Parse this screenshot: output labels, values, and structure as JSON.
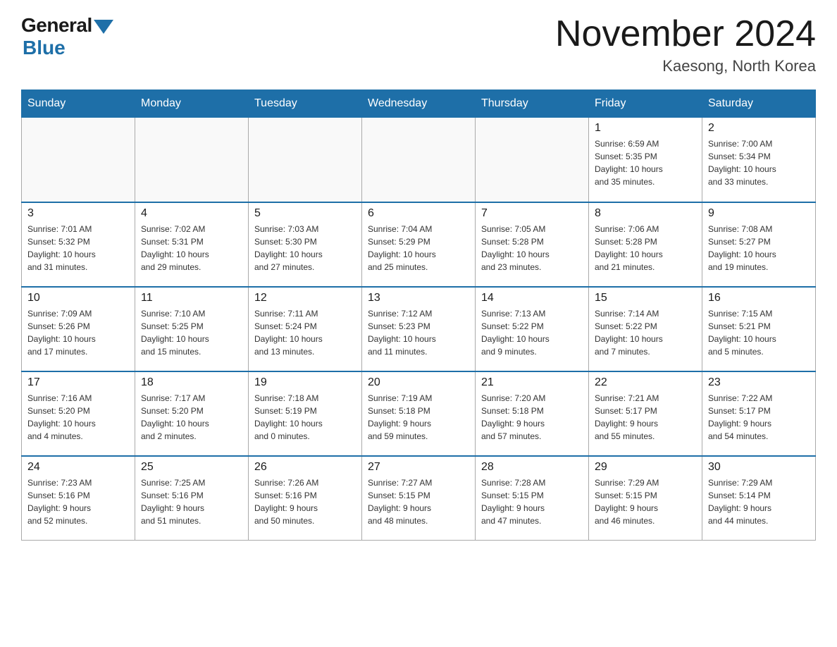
{
  "logo": {
    "general": "General",
    "blue": "Blue"
  },
  "title": "November 2024",
  "location": "Kaesong, North Korea",
  "days_of_week": [
    "Sunday",
    "Monday",
    "Tuesday",
    "Wednesday",
    "Thursday",
    "Friday",
    "Saturday"
  ],
  "weeks": [
    [
      {
        "day": "",
        "info": ""
      },
      {
        "day": "",
        "info": ""
      },
      {
        "day": "",
        "info": ""
      },
      {
        "day": "",
        "info": ""
      },
      {
        "day": "",
        "info": ""
      },
      {
        "day": "1",
        "info": "Sunrise: 6:59 AM\nSunset: 5:35 PM\nDaylight: 10 hours\nand 35 minutes."
      },
      {
        "day": "2",
        "info": "Sunrise: 7:00 AM\nSunset: 5:34 PM\nDaylight: 10 hours\nand 33 minutes."
      }
    ],
    [
      {
        "day": "3",
        "info": "Sunrise: 7:01 AM\nSunset: 5:32 PM\nDaylight: 10 hours\nand 31 minutes."
      },
      {
        "day": "4",
        "info": "Sunrise: 7:02 AM\nSunset: 5:31 PM\nDaylight: 10 hours\nand 29 minutes."
      },
      {
        "day": "5",
        "info": "Sunrise: 7:03 AM\nSunset: 5:30 PM\nDaylight: 10 hours\nand 27 minutes."
      },
      {
        "day": "6",
        "info": "Sunrise: 7:04 AM\nSunset: 5:29 PM\nDaylight: 10 hours\nand 25 minutes."
      },
      {
        "day": "7",
        "info": "Sunrise: 7:05 AM\nSunset: 5:28 PM\nDaylight: 10 hours\nand 23 minutes."
      },
      {
        "day": "8",
        "info": "Sunrise: 7:06 AM\nSunset: 5:28 PM\nDaylight: 10 hours\nand 21 minutes."
      },
      {
        "day": "9",
        "info": "Sunrise: 7:08 AM\nSunset: 5:27 PM\nDaylight: 10 hours\nand 19 minutes."
      }
    ],
    [
      {
        "day": "10",
        "info": "Sunrise: 7:09 AM\nSunset: 5:26 PM\nDaylight: 10 hours\nand 17 minutes."
      },
      {
        "day": "11",
        "info": "Sunrise: 7:10 AM\nSunset: 5:25 PM\nDaylight: 10 hours\nand 15 minutes."
      },
      {
        "day": "12",
        "info": "Sunrise: 7:11 AM\nSunset: 5:24 PM\nDaylight: 10 hours\nand 13 minutes."
      },
      {
        "day": "13",
        "info": "Sunrise: 7:12 AM\nSunset: 5:23 PM\nDaylight: 10 hours\nand 11 minutes."
      },
      {
        "day": "14",
        "info": "Sunrise: 7:13 AM\nSunset: 5:22 PM\nDaylight: 10 hours\nand 9 minutes."
      },
      {
        "day": "15",
        "info": "Sunrise: 7:14 AM\nSunset: 5:22 PM\nDaylight: 10 hours\nand 7 minutes."
      },
      {
        "day": "16",
        "info": "Sunrise: 7:15 AM\nSunset: 5:21 PM\nDaylight: 10 hours\nand 5 minutes."
      }
    ],
    [
      {
        "day": "17",
        "info": "Sunrise: 7:16 AM\nSunset: 5:20 PM\nDaylight: 10 hours\nand 4 minutes."
      },
      {
        "day": "18",
        "info": "Sunrise: 7:17 AM\nSunset: 5:20 PM\nDaylight: 10 hours\nand 2 minutes."
      },
      {
        "day": "19",
        "info": "Sunrise: 7:18 AM\nSunset: 5:19 PM\nDaylight: 10 hours\nand 0 minutes."
      },
      {
        "day": "20",
        "info": "Sunrise: 7:19 AM\nSunset: 5:18 PM\nDaylight: 9 hours\nand 59 minutes."
      },
      {
        "day": "21",
        "info": "Sunrise: 7:20 AM\nSunset: 5:18 PM\nDaylight: 9 hours\nand 57 minutes."
      },
      {
        "day": "22",
        "info": "Sunrise: 7:21 AM\nSunset: 5:17 PM\nDaylight: 9 hours\nand 55 minutes."
      },
      {
        "day": "23",
        "info": "Sunrise: 7:22 AM\nSunset: 5:17 PM\nDaylight: 9 hours\nand 54 minutes."
      }
    ],
    [
      {
        "day": "24",
        "info": "Sunrise: 7:23 AM\nSunset: 5:16 PM\nDaylight: 9 hours\nand 52 minutes."
      },
      {
        "day": "25",
        "info": "Sunrise: 7:25 AM\nSunset: 5:16 PM\nDaylight: 9 hours\nand 51 minutes."
      },
      {
        "day": "26",
        "info": "Sunrise: 7:26 AM\nSunset: 5:16 PM\nDaylight: 9 hours\nand 50 minutes."
      },
      {
        "day": "27",
        "info": "Sunrise: 7:27 AM\nSunset: 5:15 PM\nDaylight: 9 hours\nand 48 minutes."
      },
      {
        "day": "28",
        "info": "Sunrise: 7:28 AM\nSunset: 5:15 PM\nDaylight: 9 hours\nand 47 minutes."
      },
      {
        "day": "29",
        "info": "Sunrise: 7:29 AM\nSunset: 5:15 PM\nDaylight: 9 hours\nand 46 minutes."
      },
      {
        "day": "30",
        "info": "Sunrise: 7:29 AM\nSunset: 5:14 PM\nDaylight: 9 hours\nand 44 minutes."
      }
    ]
  ]
}
